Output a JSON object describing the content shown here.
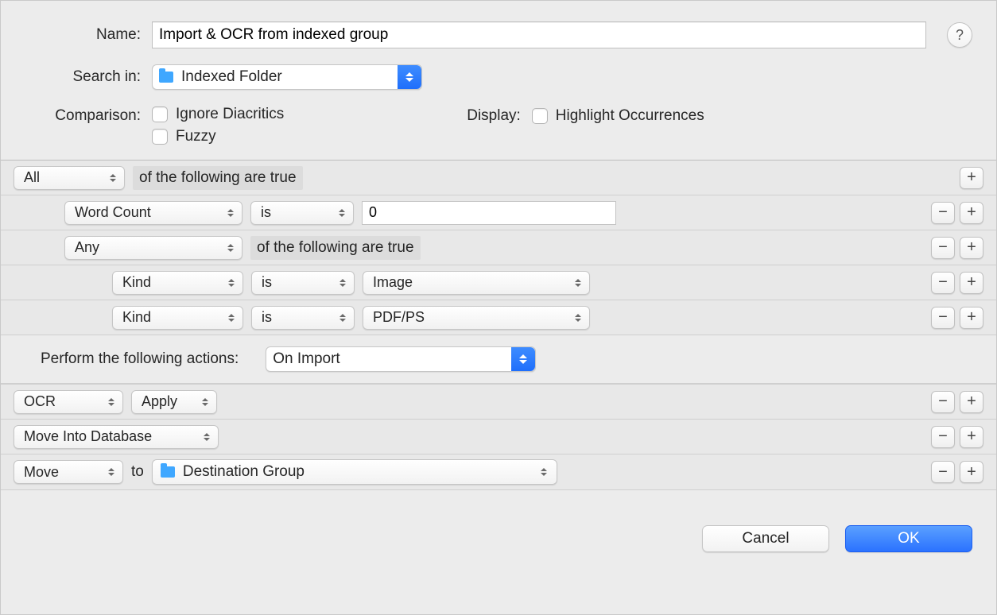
{
  "labels": {
    "name": "Name:",
    "search_in": "Search in:",
    "comparison": "Comparison:",
    "display": "Display:",
    "perform_actions": "Perform the following actions:",
    "to": "to"
  },
  "name_value": "Import & OCR from indexed group",
  "search_in_value": "Indexed Folder",
  "comparison": {
    "ignore_diacritics": "Ignore Diacritics",
    "fuzzy": "Fuzzy"
  },
  "display_opts": {
    "highlight": "Highlight Occurrences"
  },
  "rules": {
    "root_match": "All",
    "root_suffix": "of the following are true",
    "r1_field": "Word Count",
    "r1_op": "is",
    "r1_value": "0",
    "r2_match": "Any",
    "r2_suffix": "of the following are true",
    "r3_field": "Kind",
    "r3_op": "is",
    "r3_value": "Image",
    "r4_field": "Kind",
    "r4_op": "is",
    "r4_value": "PDF/PS"
  },
  "actions_trigger": "On Import",
  "actions": {
    "a1_type": "OCR",
    "a1_param": "Apply",
    "a2_type": "Move Into Database",
    "a3_type": "Move",
    "a3_dest": "Destination Group"
  },
  "buttons": {
    "cancel": "Cancel",
    "ok": "OK",
    "help": "?",
    "plus": "+",
    "minus": "−"
  }
}
